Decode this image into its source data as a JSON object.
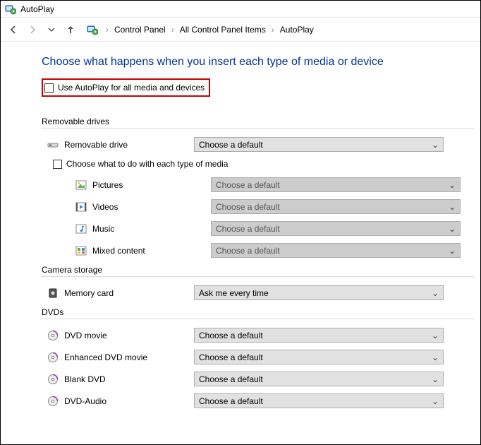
{
  "window": {
    "title": "AutoPlay"
  },
  "breadcrumb": {
    "items": [
      {
        "label": "Control Panel"
      },
      {
        "label": "All Control Panel Items"
      },
      {
        "label": "AutoPlay"
      }
    ]
  },
  "heading": "Choose what happens when you insert each type of media or device",
  "master_checkbox": {
    "label": "Use AutoPlay for all media and devices"
  },
  "sections": {
    "removable": {
      "title": "Removable drives",
      "drive": {
        "label": "Removable drive",
        "value": "Choose a default"
      },
      "subcheck": {
        "label": "Choose what to do with each type of media"
      },
      "types": [
        {
          "key": "pictures",
          "label": "Pictures",
          "value": "Choose a default"
        },
        {
          "key": "videos",
          "label": "Videos",
          "value": "Choose a default"
        },
        {
          "key": "music",
          "label": "Music",
          "value": "Choose a default"
        },
        {
          "key": "mixed",
          "label": "Mixed content",
          "value": "Choose a default"
        }
      ]
    },
    "camera": {
      "title": "Camera storage",
      "item": {
        "label": "Memory card",
        "value": "Ask me every time"
      }
    },
    "dvds": {
      "title": "DVDs",
      "items": [
        {
          "key": "dvdmovie",
          "label": "DVD movie",
          "value": "Choose a default"
        },
        {
          "key": "enhdvd",
          "label": "Enhanced DVD movie",
          "value": "Choose a default"
        },
        {
          "key": "blankdvd",
          "label": "Blank DVD",
          "value": "Choose a default"
        },
        {
          "key": "dvdaudio",
          "label": "DVD-Audio",
          "value": "Choose a default"
        }
      ]
    }
  }
}
